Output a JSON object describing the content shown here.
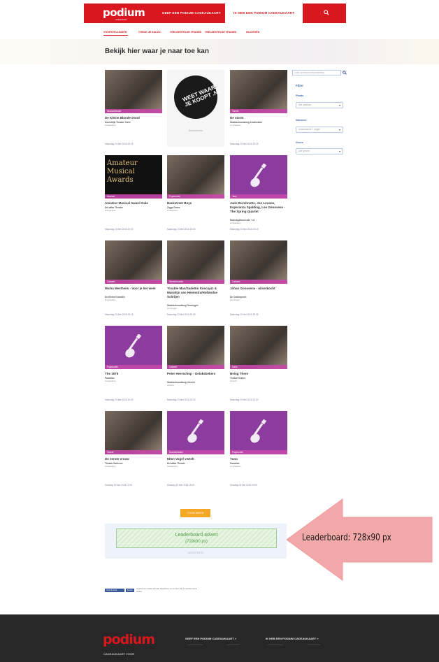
{
  "header": {
    "logo": "podium",
    "logo_sub": "cadeaukaart",
    "nav": [
      {
        "label": "GEEF EEN PODIUM CADEAUKAART",
        "active": false
      },
      {
        "label": "IK HEB EEN PODIUM CADEAUKAART",
        "active": true
      }
    ]
  },
  "subnav": {
    "items": [
      "VOORSTELLINGEN",
      "CHECK JE SALDO",
      "VEELGESTELDE VRAGEN",
      "VEELGESTELDE VRAGEN",
      "INLOGGEN"
    ]
  },
  "page": {
    "title": "Bekijk hier waar je naar toe kan"
  },
  "events": [
    {
      "category": "Musicaltheater",
      "title": "De Kleine Blonde Dood",
      "venue": "Koninklijk Theater Carré",
      "city": "Amsterdam",
      "date": "Maandag 23 Mei 2016 20:15",
      "image": "photo"
    },
    {
      "ad": true,
      "ad_text": "WEET WAAR JE KOOPT .NL",
      "label": "Advertentie"
    },
    {
      "category": "Toneel",
      "title": "De storm",
      "venue": "Stadsschouwburg Amsterdam",
      "city": "Amsterdam",
      "date": "Maandag 23 Mei 2016 20:15",
      "image": "photo"
    },
    {
      "category": "Musical",
      "title": "Amateur Musical Award Gala",
      "venue": "DeLaMar Theater",
      "city": "Amsterdam",
      "date": "Maandag 23 Mei 2016 20:00",
      "image": "awards"
    },
    {
      "category": "Popmuziek",
      "title": "Backstreet Boys",
      "venue": "Ziggo Dome",
      "city": "Amsterdam",
      "date": "Maandag 23 Mei 2016 20:00",
      "image": "photo"
    },
    {
      "category": "Jazz",
      "title": "Jack DeJohnette, Joe Lovano, Esperanza Spalding, Leo Genovese - The Spring Quartet",
      "venue": "Muziekgebouw aan 't IJ",
      "city": "Amsterdam",
      "date": "Maandag 23 Mei 2016 20:15",
      "image": "guitar"
    },
    {
      "category": "Cabaret",
      "title": "Micha Wertheim - Voor je het weet",
      "venue": "De Kleine Komedie",
      "city": "Amsterdam",
      "date": "Maandag 23 Mei 2016 20:15",
      "image": "photo"
    },
    {
      "category": "Wereldmuziek",
      "title": "Trouble Man/Sadettin Kimciyuz & Marjolijn van Heemstra/Hollandse Schrijen",
      "venue": "Stadsschouwburg Groningen",
      "city": "Groningen",
      "date": "Maandag 23 Mei 2016 20:15",
      "image": "photo"
    },
    {
      "category": "Cabaret",
      "title": "Johan Goossens - uitverkocht",
      "venue": "De Oosterpoort",
      "city": "Groningen",
      "date": "Maandag 23 Mei 2016 20:15",
      "image": "photo"
    },
    {
      "category": "Popmuziek",
      "title": "The 1975",
      "venue": "Paradiso",
      "city": "Amsterdam",
      "date": "Maandag 23 Mei 2016 20:30",
      "image": "guitar"
    },
    {
      "category": "Cabaret",
      "title": "Peter Heerschop - Geluksbekers",
      "venue": "Stadsschouwburg Utrecht",
      "city": "Utrecht",
      "date": "Maandag 23 Mei 2016 20:30",
      "image": "photo"
    },
    {
      "category": "Dans",
      "title": "Being There",
      "venue": "Theater Kikker",
      "city": "Utrecht",
      "date": "Maandag 23 Mei 2016 21:00",
      "image": "photo"
    },
    {
      "category": "Toneel",
      "title": "De eerste vrouw",
      "venue": "Theater Bellevue",
      "city": "Amsterdam",
      "date": "Dinsdag 24 Mei 2016 12:30",
      "image": "photo"
    },
    {
      "category": "Muziektheater",
      "title": "Ellen Vogel vertelt",
      "venue": "DeLaMar Theater",
      "city": "Amsterdam",
      "date": "Dinsdag 24 Mei 2016 15:00",
      "image": "guitar"
    },
    {
      "category": "Popmuziek",
      "title": "Yuna",
      "venue": "Paradiso",
      "city": "Amsterdam",
      "date": "Dinsdag 24 Mei 2016 19:00",
      "image": "guitar"
    }
  ],
  "sidebar": {
    "search_placeholder": "Zoek op trefwoord/voorstelling",
    "filter_title": "Filter",
    "place_label": "Plaats",
    "place_value": "Alle plaatsen",
    "when_label": "Wanneer",
    "when_value": "Aankomende 7 dagen",
    "genre_label": "Genre",
    "genre_value": "Alle genres"
  },
  "load_more": "TOON MEER",
  "leaderboard": {
    "line1": "Leaderboard advert",
    "line2": "(728x90 px)",
    "under": "ADVERTENTIE",
    "annotation": "Leaderboard: 728x90 px"
  },
  "social": {
    "fb_like": "Vind ik leuk",
    "fb_share": "Delen",
    "text": "3 personen vinden dit leuk. Registreer om te zien wat je vrienden leuk vinden."
  },
  "footer": {
    "logo": "podium",
    "logo_sub": "CADEAUKAART VOOR",
    "links": [
      "GEEF EEN PODIUM CADEAUKAART »",
      "IK HEB EEN PODIUM CADEAUKAART »"
    ]
  },
  "colors": {
    "brand_red": "#d8171f",
    "purple": "#8b3c9e",
    "pink_label": "#c747aa",
    "orange": "#f5a623",
    "footer_bg": "#272727"
  }
}
